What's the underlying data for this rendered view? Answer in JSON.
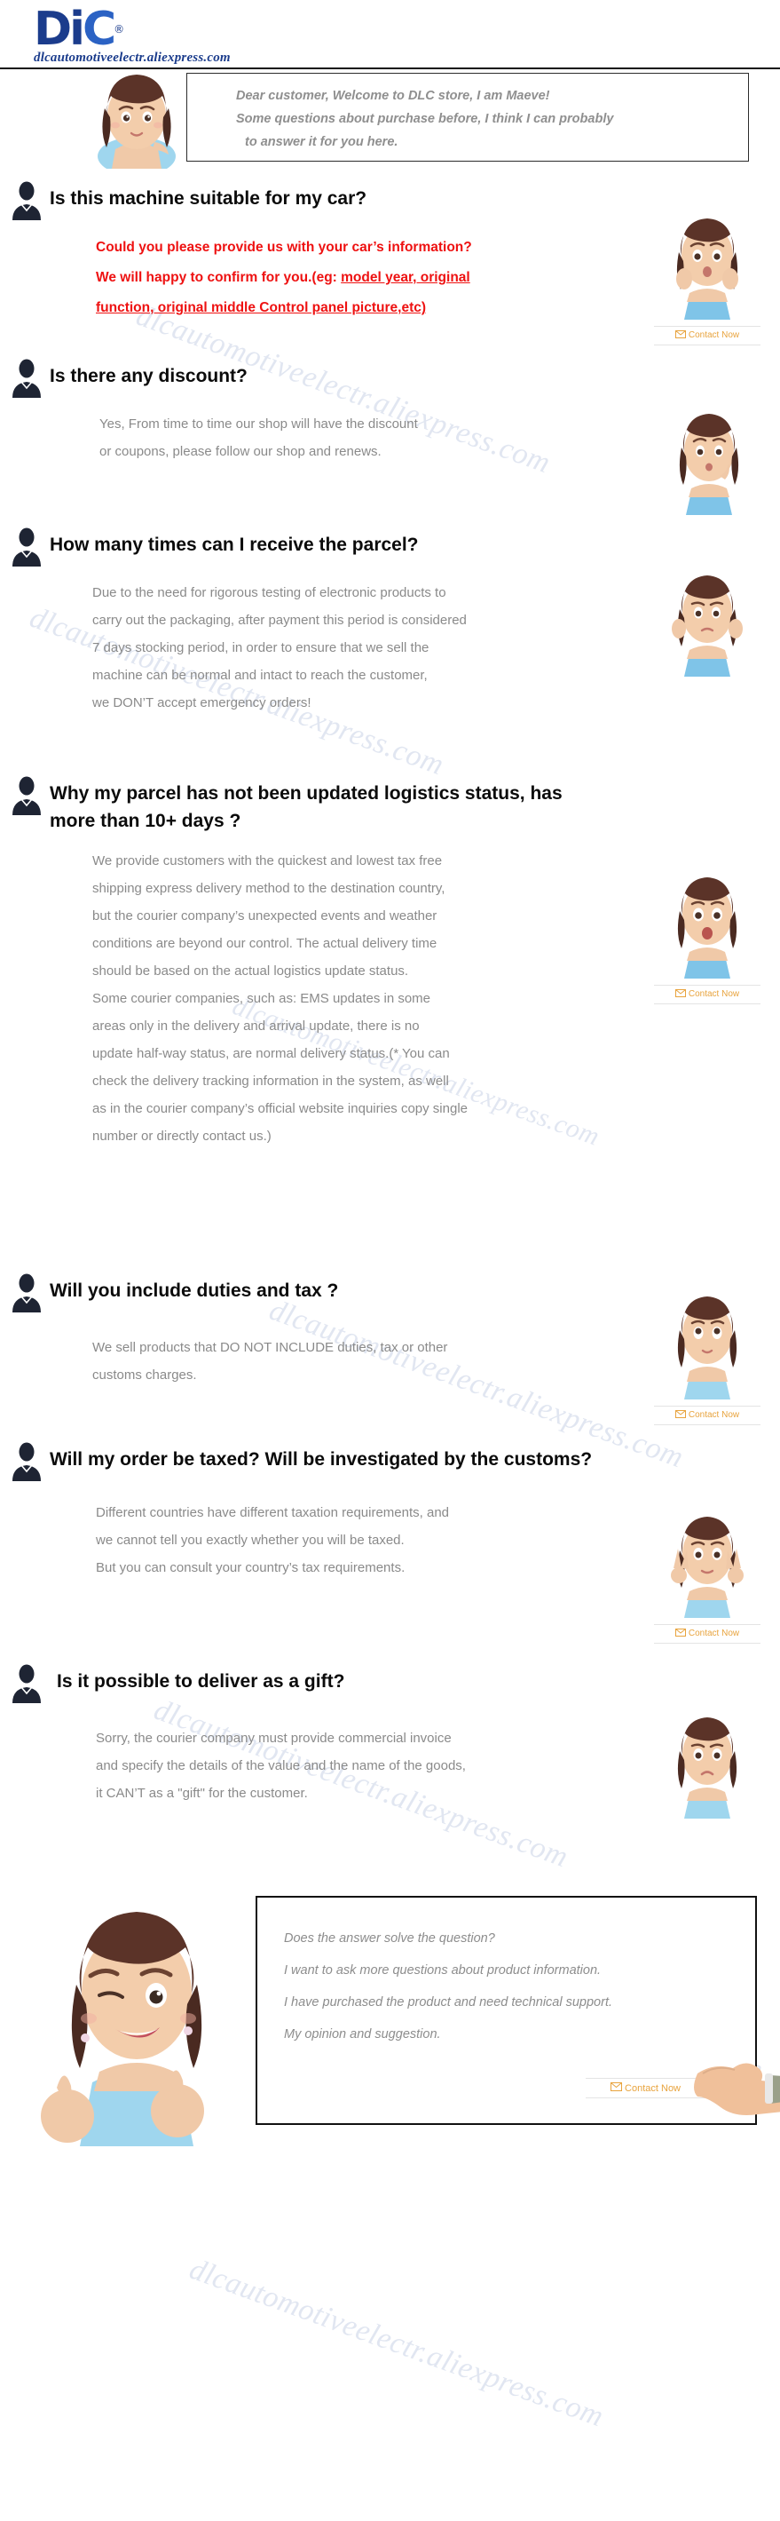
{
  "brand": {
    "logo_text_d": "D",
    "logo_text_i": "i",
    "logo_text_c": "C",
    "logo_tm": "®",
    "store_url": "dlcautomotiveelectr.aliexpress.com",
    "accent_blue": "#1b3c8c",
    "accent_orange": "#e8a33d",
    "answer_gray": "#8a8a8a",
    "alert_red": "#ee1111"
  },
  "watermark": {
    "text": "dlcautomotiveelectr.aliexpress.com"
  },
  "greeting": {
    "line1": "Dear customer, Welcome to DLC store, I am Maeve!",
    "line2": "Some questions about purchase before, I think I can probably",
    "line3": "to answer it for you here.",
    "avatar_name": "maeve-thinking-avatar"
  },
  "contact": {
    "label": "Contact Now",
    "icon": "envelope-icon"
  },
  "faq": [
    {
      "id": "fit",
      "question": "Is this machine suitable for my car?",
      "answer_style": "red",
      "answer_lines": [
        {
          "text": "Could you please provide us with your car’s information?",
          "underline": ""
        },
        {
          "text": "We will happy to confirm for you.(eg: ",
          "underline": "model year, original"
        },
        {
          "text": "",
          "underline": "function, original middle Control panel picture,etc)"
        }
      ],
      "avatar_name": "maeve-surprised-avatar",
      "has_contact": true
    },
    {
      "id": "discount",
      "question": "Is there any discount?",
      "answer_style": "gray",
      "answer_lines": [
        {
          "text": "Yes, From time to time our shop will have the discount",
          "underline": ""
        },
        {
          "text": "or coupons, please follow our shop and renews.",
          "underline": ""
        }
      ],
      "avatar_name": "maeve-pondering-avatar",
      "has_contact": false
    },
    {
      "id": "parcel-time",
      "question": "How many times can I receive the parcel?",
      "answer_style": "gray",
      "answer_lines": [
        {
          "text": "Due to the need for rigorous testing of electronic products to",
          "underline": ""
        },
        {
          "text": "carry out the packaging, after payment this period is considered",
          "underline": ""
        },
        {
          "text": "7 days stocking period, in order to ensure that we sell the",
          "underline": ""
        },
        {
          "text": "machine can be normal and intact to reach the customer,",
          "underline": ""
        },
        {
          "text": "we DON’T accept emergency orders!",
          "underline": ""
        }
      ],
      "avatar_name": "maeve-worried-avatar",
      "has_contact": false
    },
    {
      "id": "logistics",
      "question": "Why my parcel has not been updated logistics status, has more than 10+ days ?",
      "answer_style": "gray",
      "answer_lines": [
        {
          "text": "We provide customers with the quickest and lowest tax free",
          "underline": ""
        },
        {
          "text": "shipping express delivery method to the destination country,",
          "underline": ""
        },
        {
          "text": "but the courier company’s unexpected events and weather",
          "underline": ""
        },
        {
          "text": "conditions are beyond our control. The actual delivery time",
          "underline": ""
        },
        {
          "text": "should be based on the actual logistics update status.",
          "underline": ""
        },
        {
          "text": "Some courier companies, such as: EMS updates in some",
          "underline": ""
        },
        {
          "text": "areas only in the delivery and arrival update, there is no",
          "underline": ""
        },
        {
          "text": "update half-way status, are normal delivery status.(* You can",
          "underline": ""
        },
        {
          "text": " check the delivery tracking information in the system, as well",
          "underline": ""
        },
        {
          "text": "as in the courier company’s official website inquiries copy single",
          "underline": ""
        },
        {
          "text": " number or directly contact us.)",
          "underline": ""
        }
      ],
      "avatar_name": "maeve-shocked-avatar",
      "has_contact": true
    },
    {
      "id": "duties",
      "question": "Will you include duties and tax ?",
      "answer_style": "gray",
      "answer_lines": [
        {
          "text": "We sell products that DO NOT INCLUDE duties, tax or other",
          "underline": ""
        },
        {
          "text": "customs charges.",
          "underline": ""
        }
      ],
      "avatar_name": "maeve-lookup-avatar",
      "has_contact": true
    },
    {
      "id": "taxed",
      "question": "Will my order be taxed? Will be investigated by the customs?",
      "answer_style": "gray",
      "answer_lines": [
        {
          "text": "Different countries have different taxation requirements, and",
          "underline": ""
        },
        {
          "text": " we cannot tell you exactly whether you will be taxed.",
          "underline": ""
        },
        {
          "text": "But you can consult your country’s tax requirements.",
          "underline": ""
        }
      ],
      "avatar_name": "maeve-peace-sign-avatar",
      "has_contact": true
    },
    {
      "id": "gift",
      "question": "Is it possible to deliver as a gift?",
      "answer_style": "gray",
      "answer_lines": [
        {
          "text": "Sorry, the courier company must provide commercial invoice",
          "underline": ""
        },
        {
          "text": "and specify the details of the value and the name of the goods,",
          "underline": ""
        },
        {
          "text": "it CAN’T as a \"gift\" for the customer.",
          "underline": ""
        }
      ],
      "avatar_name": "maeve-sad-avatar",
      "has_contact": false
    }
  ],
  "footer": {
    "lines": [
      "Does the answer solve the question?",
      "I want to ask more questions about product information.",
      "I have purchased the product and need technical support.",
      "My opinion and suggestion."
    ],
    "contact_label": "Contact Now",
    "avatar_name": "maeve-thumbs-up-avatar",
    "pointer_name": "pointing-hand-icon"
  }
}
